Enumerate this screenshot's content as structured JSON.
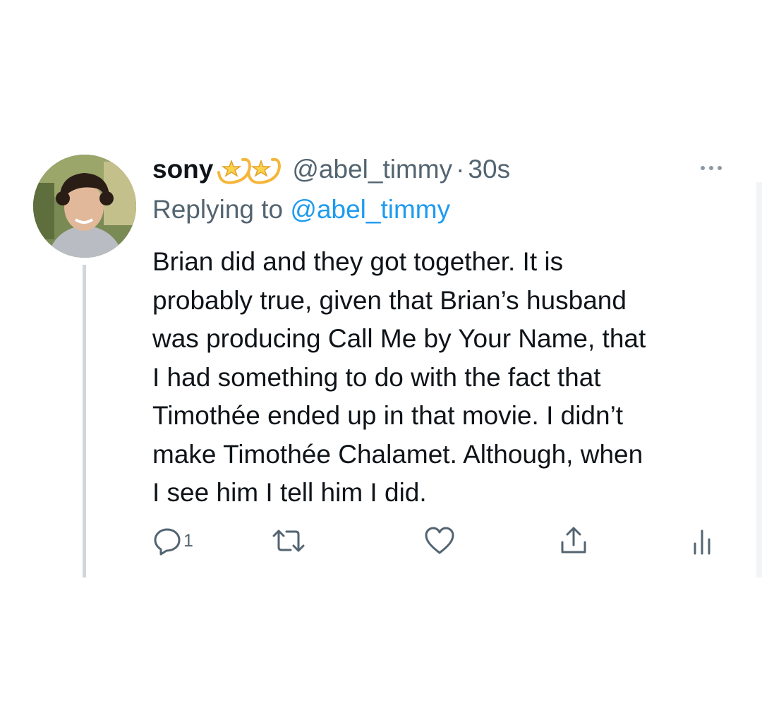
{
  "tweet": {
    "display_name": "sony",
    "name_emojis": [
      "dizzy-star-emoji",
      "dizzy-star-emoji"
    ],
    "handle": "@abel_timmy",
    "separator": "·",
    "time": "30s",
    "replying_prefix": "Replying to",
    "replying_to": "@abel_timmy",
    "body_lines": [
      "Brian did and they got together. It is",
      "probably true, given that Brian’s husband",
      "was producing Call Me by Your Name, that",
      "I had something to do with the fact that",
      "Timothée ended up in that movie. I didn’t",
      "make Timothée Chalamet. Although, when",
      "I see him I tell him I did."
    ],
    "actions": {
      "reply_icon": "reply-icon",
      "reply_count": "1",
      "retweet_icon": "retweet-icon",
      "like_icon": "heart-icon",
      "share_icon": "share-icon",
      "analytics_icon": "analytics-icon",
      "more_icon": "more-horizontal-icon"
    }
  },
  "colors": {
    "text": "#0f1419",
    "secondary": "#536471",
    "link": "#1d9bf0",
    "thread_line": "#cfd6dc"
  }
}
